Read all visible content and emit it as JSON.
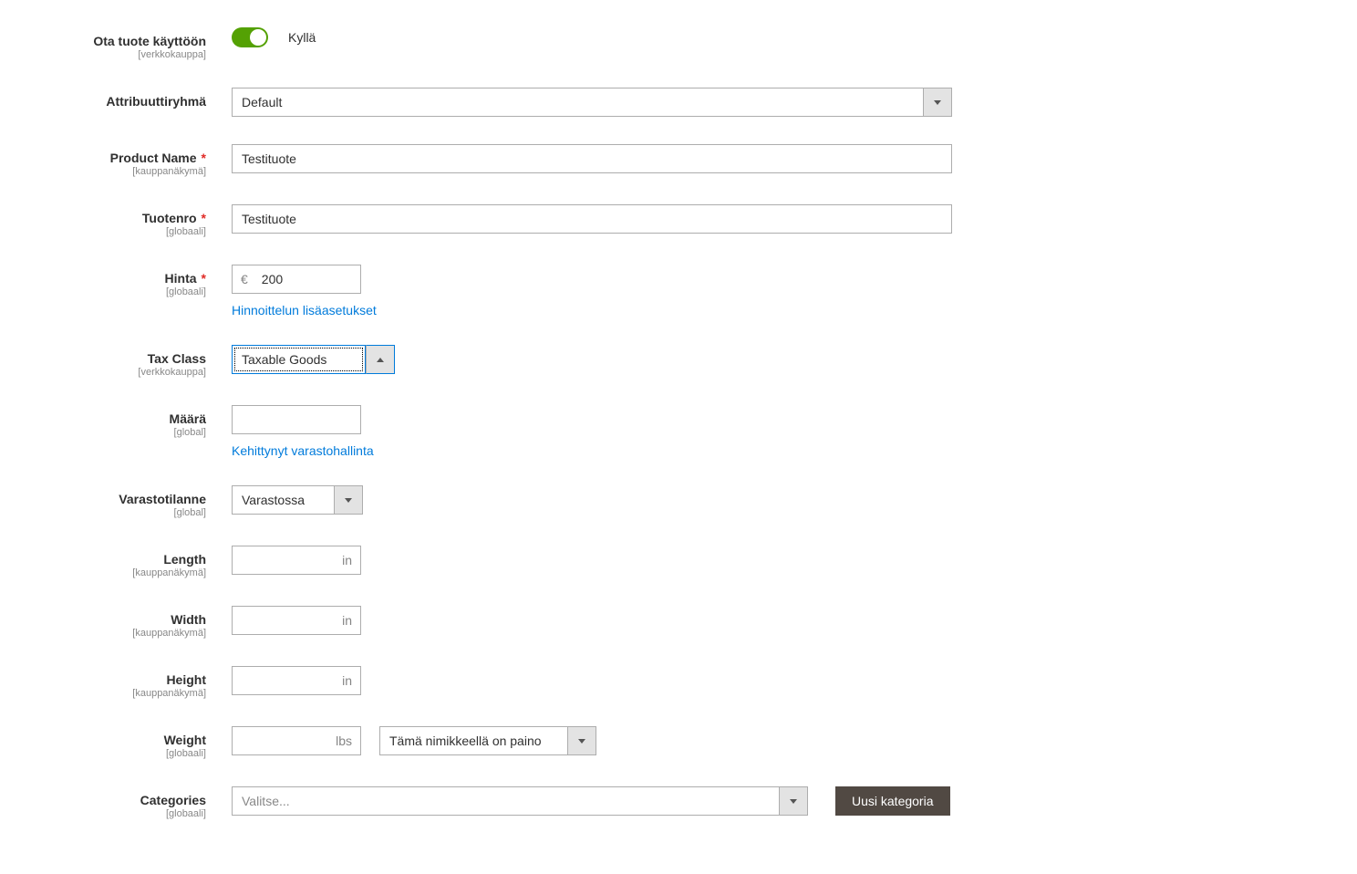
{
  "enable": {
    "label": "Ota tuote käyttöön",
    "scope": "[verkkokauppa]",
    "value": "Kyllä"
  },
  "attributeSet": {
    "label": "Attribuuttiryhmä",
    "value": "Default"
  },
  "productName": {
    "label": "Product Name",
    "scope": "[kauppanäkymä]",
    "value": "Testituote"
  },
  "sku": {
    "label": "Tuotenro",
    "scope": "[globaali]",
    "value": "Testituote"
  },
  "price": {
    "label": "Hinta",
    "scope": "[globaali]",
    "currency": "€",
    "value": "200",
    "advancedLink": "Hinnoittelun lisäasetukset"
  },
  "taxClass": {
    "label": "Tax Class",
    "scope": "[verkkokauppa]",
    "value": "Taxable Goods"
  },
  "quantity": {
    "label": "Määrä",
    "scope": "[global]",
    "value": "",
    "advancedLink": "Kehittynyt varastohallinta"
  },
  "stockStatus": {
    "label": "Varastotilanne",
    "scope": "[global]",
    "value": "Varastossa"
  },
  "length": {
    "label": "Length",
    "scope": "[kauppanäkymä]",
    "unit": "in",
    "value": ""
  },
  "width": {
    "label": "Width",
    "scope": "[kauppanäkymä]",
    "unit": "in",
    "value": ""
  },
  "height": {
    "label": "Height",
    "scope": "[kauppanäkymä]",
    "unit": "in",
    "value": ""
  },
  "weight": {
    "label": "Weight",
    "scope": "[globaali]",
    "unit": "lbs",
    "value": "",
    "hasWeight": "Tämä nimikkeellä on paino"
  },
  "categories": {
    "label": "Categories",
    "scope": "[globaali]",
    "placeholder": "Valitse...",
    "newButton": "Uusi kategoria"
  }
}
